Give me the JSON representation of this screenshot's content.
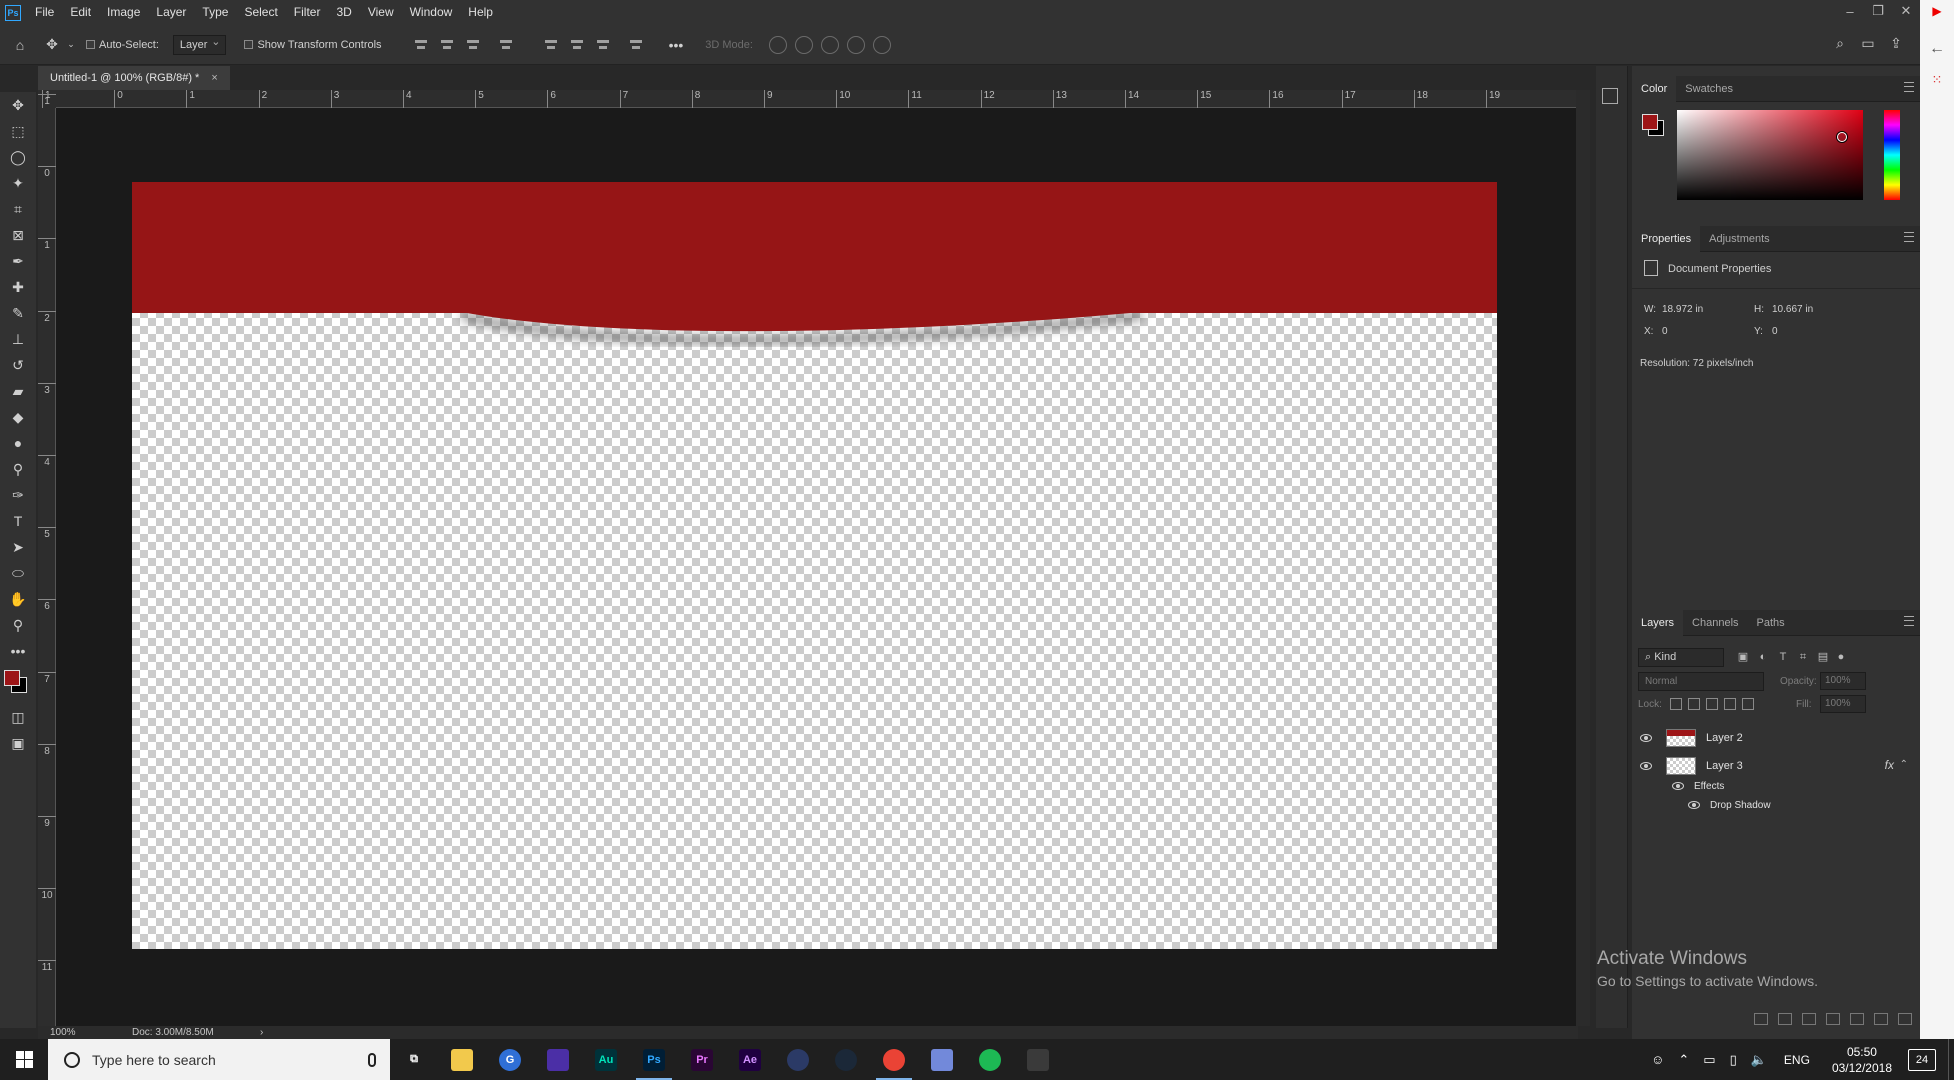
{
  "app": {
    "logo": "Ps",
    "menu": [
      "File",
      "Edit",
      "Image",
      "Layer",
      "Type",
      "Select",
      "Filter",
      "3D",
      "View",
      "Window",
      "Help"
    ],
    "window_controls": [
      "minimize",
      "restore",
      "close"
    ]
  },
  "options_bar": {
    "auto_select_label": "Auto-Select:",
    "auto_select_target": "Layer",
    "show_transform_label": "Show Transform Controls",
    "more_label": "•••",
    "mode_label": "3D Mode:"
  },
  "toolbox": {
    "tools": [
      "move-tool-icon",
      "marquee-tool-icon",
      "lasso-tool-icon",
      "magic-wand-icon",
      "crop-tool-icon",
      "frame-tool-icon",
      "eyedropper-icon",
      "healing-brush-icon",
      "brush-tool-icon",
      "clone-stamp-icon",
      "history-brush-icon",
      "eraser-icon",
      "paint-bucket-icon",
      "blur-tool-icon",
      "dodge-tool-icon",
      "pen-tool-icon",
      "type-tool-icon",
      "path-select-icon",
      "ellipse-tool-icon",
      "hand-tool-icon",
      "zoom-tool-icon",
      "more-tools-icon"
    ],
    "more_label": "•••",
    "foreground_color": "#9d1517",
    "background_color": "#000000"
  },
  "document": {
    "tab_title": "Untitled-1 @ 100% (RGB/8#) *",
    "close_label": "×",
    "canvas_color": "#9d1517",
    "zoom": "100%",
    "doc_size": "Doc: 3.00M/8.50M"
  },
  "rulers": {
    "horizontal": [
      "1",
      "0",
      "1",
      "2",
      "3",
      "4",
      "5",
      "6",
      "7",
      "8",
      "9",
      "10",
      "11",
      "12",
      "13",
      "14",
      "15",
      "16",
      "17",
      "18",
      "19"
    ],
    "vertical": [
      "1",
      "0",
      "1",
      "2",
      "3",
      "4",
      "5",
      "6",
      "7",
      "8",
      "9",
      "10",
      "11"
    ]
  },
  "color_panel": {
    "tabs": [
      "Color",
      "Swatches"
    ],
    "hue_color": "#e00014"
  },
  "properties_panel": {
    "tabs": [
      "Properties",
      "Adjustments"
    ],
    "section_title": "Document Properties",
    "width_label": "W:",
    "width_value": "18.972 in",
    "height_label": "H:",
    "height_value": "10.667 in",
    "x_label": "X:",
    "x_value": "0",
    "y_label": "Y:",
    "y_value": "0",
    "resolution": "Resolution: 72 pixels/inch"
  },
  "layers_panel": {
    "tabs": [
      "Layers",
      "Channels",
      "Paths"
    ],
    "kind_label": "Kind",
    "blend_mode": "Normal",
    "opacity_label": "Opacity:",
    "opacity_value": "100%",
    "lock_label": "Lock:",
    "fill_label": "Fill:",
    "fill_value": "100%",
    "layers": [
      {
        "name": "Layer 2"
      },
      {
        "name": "Layer 3",
        "fx": "fx"
      }
    ],
    "effects_label": "Effects",
    "drop_shadow_label": "Drop Shadow"
  },
  "watermark": {
    "title": "Activate Windows",
    "subtitle": "Go to Settings to activate Windows."
  },
  "taskbar": {
    "search_placeholder": "Type here to search",
    "apps": [
      {
        "name": "task-view",
        "label": "⧉",
        "bg": "transparent",
        "fg": "#ffffff"
      },
      {
        "name": "file-explorer",
        "label": "",
        "bg": "#f2c94c",
        "fg": "#000"
      },
      {
        "name": "app-g",
        "label": "G",
        "bg": "#2f6fd6",
        "fg": "#fff"
      },
      {
        "name": "app-purple",
        "label": "",
        "bg": "#4b2fa6",
        "fg": "#fff"
      },
      {
        "name": "audition",
        "label": "Au",
        "bg": "#00323a",
        "fg": "#00e4bb"
      },
      {
        "name": "photoshop",
        "label": "Ps",
        "bg": "#001e36",
        "fg": "#31a8ff"
      },
      {
        "name": "premiere",
        "label": "Pr",
        "bg": "#2a0634",
        "fg": "#ea77ff"
      },
      {
        "name": "after-effects",
        "label": "Ae",
        "bg": "#1f0040",
        "fg": "#d291ff"
      },
      {
        "name": "cinema4d",
        "label": "",
        "bg": "#2b3a66",
        "fg": "#fff"
      },
      {
        "name": "steam",
        "label": "",
        "bg": "#1b2838",
        "fg": "#fff"
      },
      {
        "name": "chrome",
        "label": "",
        "bg": "#ea4335",
        "fg": "#fff"
      },
      {
        "name": "discord",
        "label": "",
        "bg": "#7289da",
        "fg": "#fff"
      },
      {
        "name": "spotify",
        "label": "",
        "bg": "#1db954",
        "fg": "#000"
      },
      {
        "name": "app-dark",
        "label": "",
        "bg": "#3a3a3a",
        "fg": "#fff"
      }
    ],
    "language": "ENG",
    "time": "05:50",
    "date": "03/12/2018",
    "notifications": "24"
  }
}
